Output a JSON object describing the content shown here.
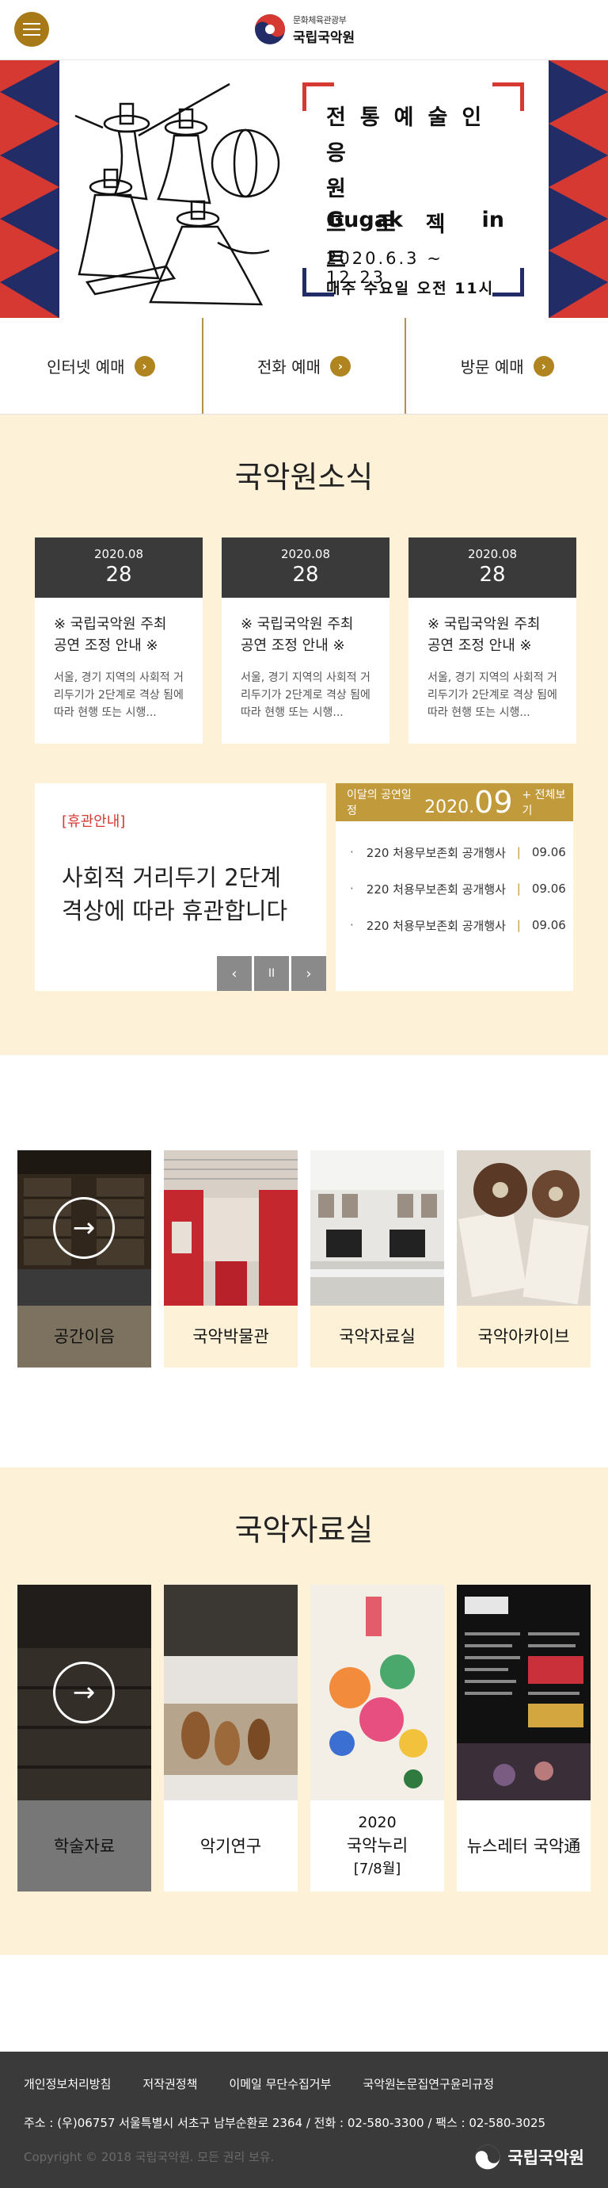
{
  "header": {
    "logo_sub": "문화체육관광부",
    "logo_main": "국립국악원"
  },
  "banner": {
    "title_line1": "전통예술인",
    "title_line2": "응원",
    "title_line3": "프로젝트",
    "title_en_left": "Gugak",
    "title_en_right": "in",
    "dates": "2020.6.3 ~ 12.23",
    "schedule": "매주 수요일 오전 11시"
  },
  "tickets": [
    {
      "label": "인터넷 예매"
    },
    {
      "label": "전화 예매"
    },
    {
      "label": "방문 예매"
    }
  ],
  "news": {
    "title": "국악원소식",
    "cards": [
      {
        "month": "2020.08",
        "day": "28",
        "title": "※ 국립국악원 주최 공연 조정 안내 ※",
        "desc": "서울, 경기 지역의 사회적 거리두기가 2단계로 격상 됨에 따라 현행 또는 시행..."
      },
      {
        "month": "2020.08",
        "day": "28",
        "title": "※ 국립국악원 주최 공연 조정 안내 ※",
        "desc": "서울, 경기 지역의 사회적 거리두기가 2단계로 격상 됨에 따라 현행 또는 시행..."
      },
      {
        "month": "2020.08",
        "day": "28",
        "title": "※ 국립국악원 주최 공연 조정 안내 ※",
        "desc": "서울, 경기 지역의 사회적 거리두기가 2단계로 격상 됨에 따라 현행 또는 시행..."
      }
    ],
    "notice_tag": "[휴관안내]",
    "notice_line1": "사회적 거리두기 2단계",
    "notice_line2": "격상에 따라 휴관합니다",
    "ctrl_prev": "‹",
    "ctrl_pause": "II",
    "ctrl_next": "›"
  },
  "schedule": {
    "label": "이달의 공연일정",
    "year": "2020.",
    "month": "09",
    "all": "+ 전체보기",
    "items": [
      {
        "dot": "·",
        "name": "220 처용무보존회 공개행사",
        "date": "09.06"
      },
      {
        "dot": "·",
        "name": "220 처용무보존회 공개행사",
        "date": "09.06"
      },
      {
        "dot": "·",
        "name": "220 처용무보존회 공개행사",
        "date": "09.06"
      }
    ]
  },
  "spaces": [
    {
      "label": "공간이음"
    },
    {
      "label": "국악박물관"
    },
    {
      "label": "국악자료실"
    },
    {
      "label": "국악아카이브"
    }
  ],
  "archive": {
    "title": "국악자료실",
    "items": [
      {
        "label": "학술자료"
      },
      {
        "label": "악기연구"
      },
      {
        "label_line1": "2020",
        "label_line2": "국악누리",
        "label_line3": "[7/8월]"
      },
      {
        "label": "뉴스레터 국악通"
      }
    ]
  },
  "footer": {
    "links": [
      "개인정보처리방침",
      "저작권정책",
      "이메일 무단수집거부",
      "국악원논문집연구윤리규정"
    ],
    "address": "주소 : (우)06757 서울특별시 서초구 남부순환로 2364 / 전화 : 02-580-3300 / 팩스 : 02-580-3025",
    "copyright": "Copyright © 2018 국립국악원. 모든 권리 보유.",
    "logo": "국립국악원"
  },
  "colors": {
    "accent": "#a77a17",
    "cream": "#fdf1d8",
    "dark": "#3a3a3a",
    "red": "#d63832",
    "navy": "#222c66"
  }
}
